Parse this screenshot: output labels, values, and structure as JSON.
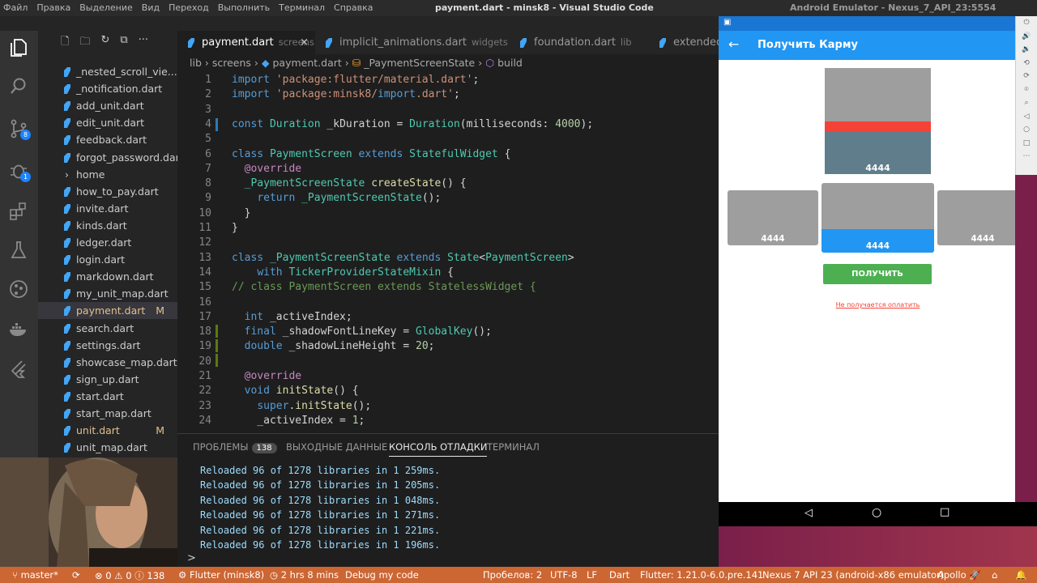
{
  "topbar": {
    "menu": [
      "Файл",
      "Правка",
      "Выделение",
      "Вид",
      "Переход",
      "Выполнить",
      "Терминал",
      "Справка"
    ],
    "vscode_title": "payment.dart - minsk8 - Visual Studio Code",
    "emulator_title": "Android Emulator - Nexus_7_API_23:5554"
  },
  "activity_badges": {
    "scm": "8",
    "debug": "1"
  },
  "explorer": {
    "files": [
      {
        "name": "_nested_scroll_vie..."
      },
      {
        "name": "_notification.dart"
      },
      {
        "name": "add_unit.dart"
      },
      {
        "name": "edit_unit.dart"
      },
      {
        "name": "feedback.dart"
      },
      {
        "name": "forgot_password.dart"
      },
      {
        "name": "home"
      },
      {
        "name": "how_to_pay.dart"
      },
      {
        "name": "invite.dart"
      },
      {
        "name": "kinds.dart"
      },
      {
        "name": "ledger.dart"
      },
      {
        "name": "login.dart"
      },
      {
        "name": "markdown.dart"
      },
      {
        "name": "my_unit_map.dart"
      },
      {
        "name": "payment.dart",
        "mark": "M"
      },
      {
        "name": "search.dart"
      },
      {
        "name": "settings.dart"
      },
      {
        "name": "showcase_map.dart"
      },
      {
        "name": "sign_up.dart"
      },
      {
        "name": "start.dart"
      },
      {
        "name": "start_map.dart"
      },
      {
        "name": "unit.dart",
        "mark": "M"
      },
      {
        "name": "unit_map.dart"
      }
    ]
  },
  "tabs": [
    {
      "name": "payment.dart",
      "dir": "screens"
    },
    {
      "name": "implicit_animations.dart",
      "dir": "widgets"
    },
    {
      "name": "foundation.dart",
      "dir": "lib"
    },
    {
      "name": "extended",
      "dir": ""
    }
  ],
  "breadcrumb": [
    "lib",
    "screens",
    "payment.dart",
    "_PaymentScreenState",
    "build"
  ],
  "code_lines": [
    {
      "n": "1",
      "t": "import 'package:flutter/material.dart';"
    },
    {
      "n": "2",
      "t": "import 'package:minsk8/import.dart';"
    },
    {
      "n": "3",
      "t": ""
    },
    {
      "n": "4",
      "t": "const Duration _kDuration = Duration(milliseconds: 4000);"
    },
    {
      "n": "5",
      "t": ""
    },
    {
      "n": "6",
      "t": "class PaymentScreen extends StatefulWidget {"
    },
    {
      "n": "7",
      "t": "  @override"
    },
    {
      "n": "8",
      "t": "  _PaymentScreenState createState() {"
    },
    {
      "n": "9",
      "t": "    return _PaymentScreenState();"
    },
    {
      "n": "10",
      "t": "  }"
    },
    {
      "n": "11",
      "t": "}"
    },
    {
      "n": "12",
      "t": ""
    },
    {
      "n": "13",
      "t": "class _PaymentScreenState extends State<PaymentScreen>"
    },
    {
      "n": "14",
      "t": "    with TickerProviderStateMixin {"
    },
    {
      "n": "15",
      "t": "// class PaymentScreen extends StatelessWidget {"
    },
    {
      "n": "16",
      "t": ""
    },
    {
      "n": "17",
      "t": "  int _activeIndex;"
    },
    {
      "n": "18",
      "t": "  final _shadowFontLineKey = GlobalKey();"
    },
    {
      "n": "19",
      "t": "  double _shadowLineHeight = 20;"
    },
    {
      "n": "20",
      "t": ""
    },
    {
      "n": "21",
      "t": "  @override"
    },
    {
      "n": "22",
      "t": "  void initState() {"
    },
    {
      "n": "23",
      "t": "    super.initState();"
    },
    {
      "n": "24",
      "t": "    _activeIndex = 1;"
    }
  ],
  "panel": {
    "tabs": [
      "ПРОБЛЕМЫ",
      "ВЫХОДНЫЕ ДАННЫЕ",
      "КОНСОЛЬ ОТЛАДКИ",
      "ТЕРМИНАЛ"
    ],
    "problems_count": "138",
    "lines": [
      "Reloaded 96 of 1278 libraries in 1 259ms.",
      "Reloaded 96 of 1278 libraries in 1 205ms.",
      "Reloaded 96 of 1278 libraries in 1 048ms.",
      "Reloaded 96 of 1278 libraries in 1 271ms.",
      "Reloaded 96 of 1278 libraries in 1 221ms.",
      "Reloaded 96 of 1278 libraries in 1 196ms."
    ],
    "prompt": ">"
  },
  "status": {
    "branch": "master*",
    "errors": "0",
    "warnings": "0",
    "info": "138",
    "flutter": "Flutter (minsk8)",
    "time": "2 hrs 8 mins",
    "debug": "Debug my code",
    "spaces": "Пробелов: 2",
    "encoding": "UTF-8",
    "eol": "LF",
    "lang": "Dart",
    "flutter_version": "Flutter: 1.21.0-6.0.pre.141",
    "device": "Nexus 7 API 23 (android-x86 emulator)",
    "apollo": "Apollo"
  },
  "app": {
    "title": "Получить Карму",
    "value": "4444",
    "button": "ПОЛУЧИТЬ",
    "link": "Не получается оплатить"
  },
  "colors": {
    "accent": "#2196f3",
    "red_bar": "#f44336",
    "green_button": "#4caf50",
    "status_bar": "#cc6633"
  }
}
